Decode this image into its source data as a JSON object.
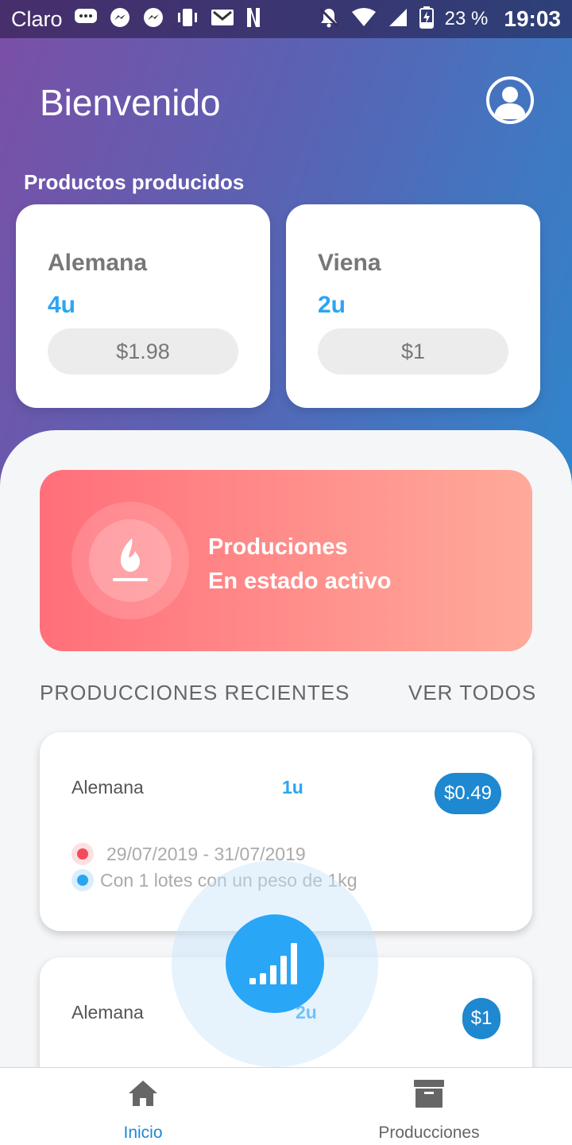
{
  "status_bar": {
    "carrier": "Claro",
    "battery": "23 %",
    "time": "19:03"
  },
  "header": {
    "title": "Bienvenido"
  },
  "products": {
    "section_title": "Productos producidos",
    "items": [
      {
        "name": "Alemana",
        "units": "4u",
        "price": "$1.98"
      },
      {
        "name": "Viena",
        "units": "2u",
        "price": "$1"
      }
    ]
  },
  "banner": {
    "line1": "Produciones",
    "line2": "En estado activo"
  },
  "recent": {
    "title": "PRODUCCIONES RECIENTES",
    "see_all": "VER TODOS",
    "items": [
      {
        "name": "Alemana",
        "units": "1u",
        "price": "$0.49",
        "dates": "29/07/2019 - 31/07/2019",
        "detail": "Con 1 lotes con un peso de 1kg"
      },
      {
        "name": "Alemana",
        "units": "2u",
        "price": "$1"
      }
    ]
  },
  "bottom_nav": {
    "items": [
      {
        "label": "Inicio",
        "icon": "home-icon",
        "active": true
      },
      {
        "label": "Producciones",
        "icon": "archive-box-icon",
        "active": false
      }
    ]
  },
  "colors": {
    "accent": "#2aa5f5",
    "badge": "#1e88d0",
    "banner_start": "#ff6f7a",
    "banner_end": "#ffaa9a"
  }
}
